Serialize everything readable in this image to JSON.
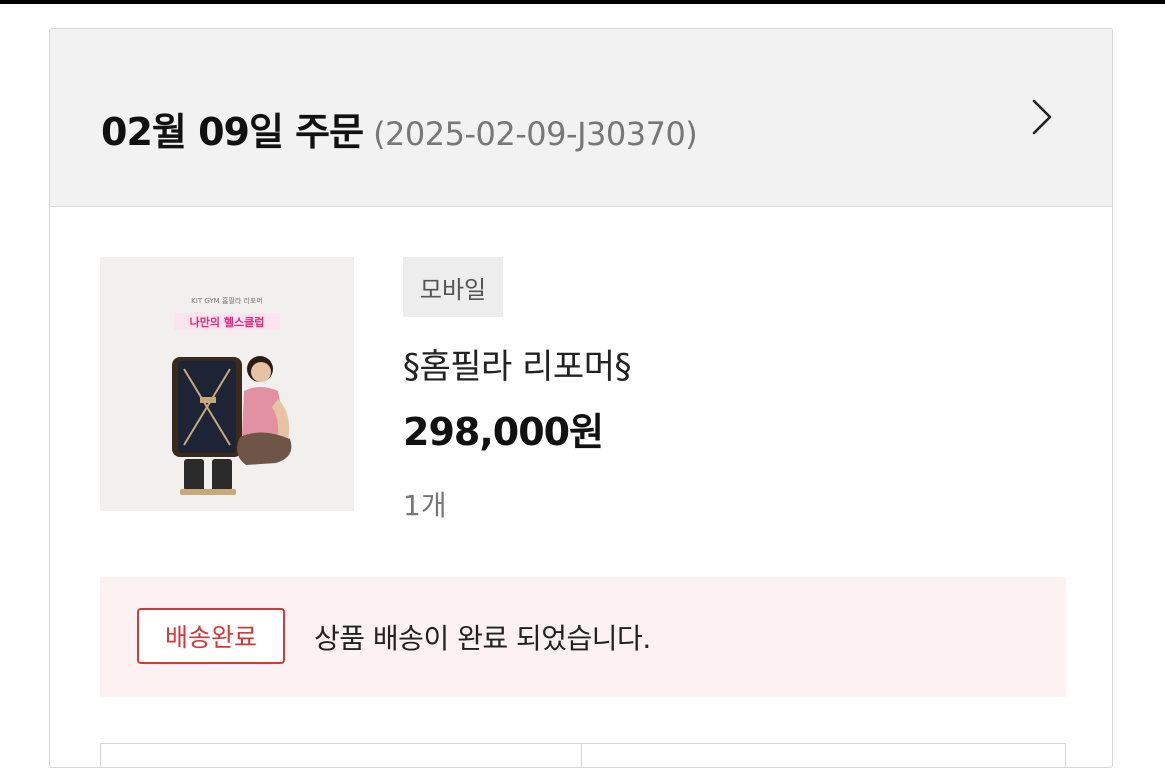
{
  "order": {
    "title": "02월 09일 주문",
    "number": "(2025-02-09-J30370)",
    "detail_icon": "chevron-right-icon"
  },
  "product": {
    "image_caption_small": "KIT GYM 홈필라 리포머",
    "image_caption_main": "나만의 헬스클럽",
    "channel": "모바일",
    "name": "§홈필라 리포머§",
    "price": "298,000원",
    "quantity": "1개"
  },
  "delivery": {
    "status": "배송완료",
    "message": "상품 배송이 완료 되었습니다."
  },
  "colors": {
    "header_bg": "#f2f2f2",
    "status_red": "#d03a3a",
    "status_bg": "#fdf1f1"
  }
}
